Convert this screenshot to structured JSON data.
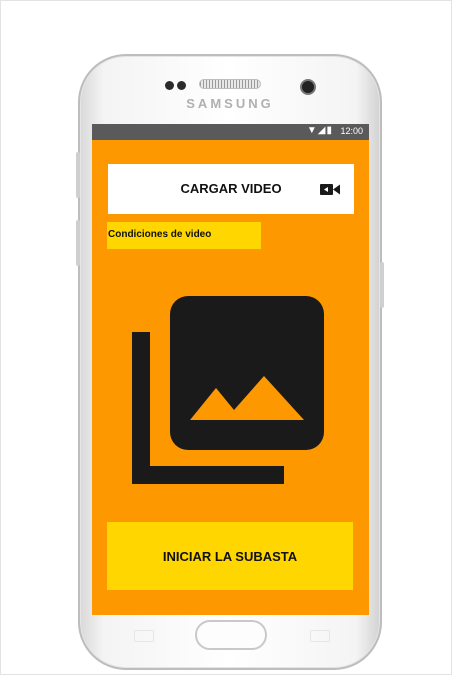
{
  "device": {
    "brand": "SAMSUNG"
  },
  "status_bar": {
    "time": "12:00",
    "icons": "wifi-icon signal-icon battery-icon"
  },
  "upload": {
    "label": "CARGAR VIDEO",
    "icon": "video-camera-icon"
  },
  "conditions": {
    "label": "Condiciones de video"
  },
  "media_placeholder": {
    "icon": "photo-library-icon"
  },
  "start": {
    "label": "INICIAR LA SUBASTA"
  },
  "colors": {
    "screen_background": "#fe9800",
    "yellow_accent": "#ffd600",
    "status_bar": "#5a5a5a",
    "icon_dark": "#1a1a1a"
  }
}
